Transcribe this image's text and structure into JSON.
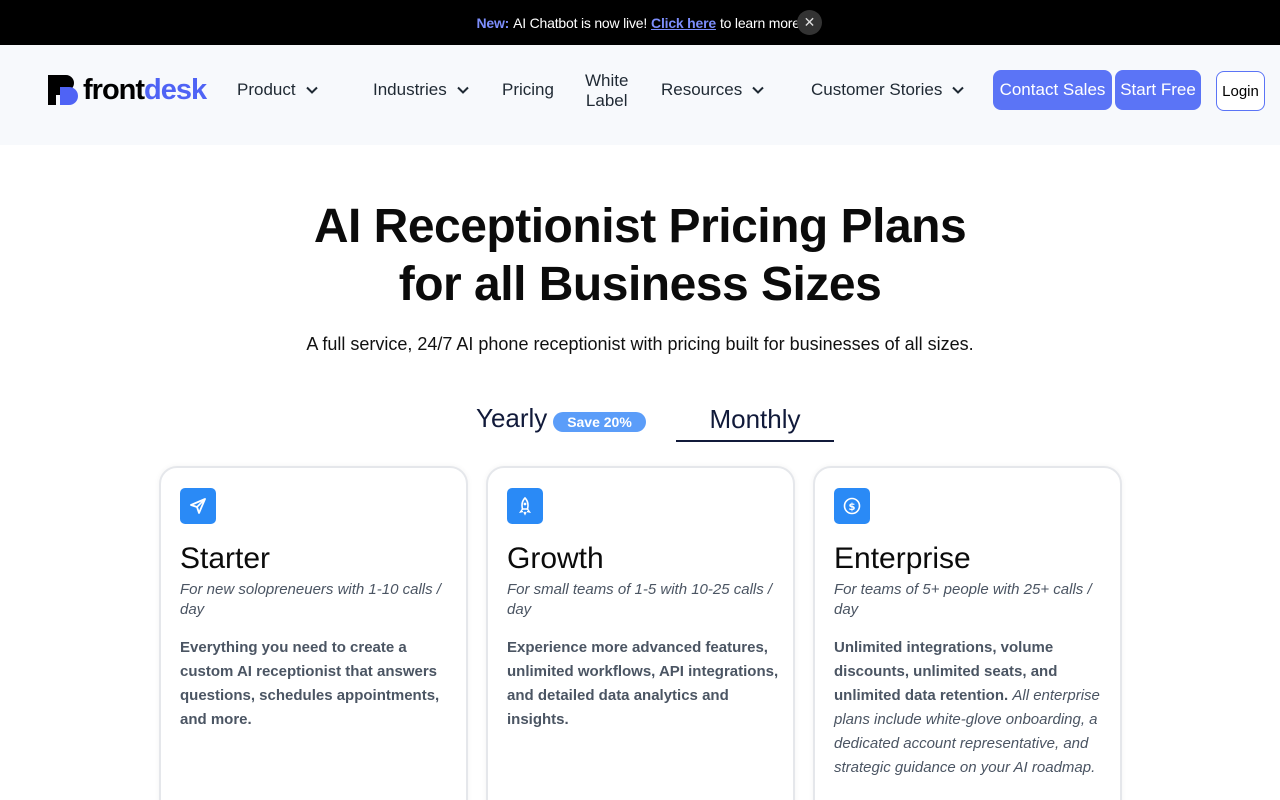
{
  "announcement": {
    "new_label": "New:",
    "text": "AI Chatbot is now live!",
    "link": "Click here",
    "after": "to learn more.",
    "close": "✕"
  },
  "header": {
    "logo_front": "front",
    "logo_desk": "desk",
    "nav": {
      "product": "Product",
      "industries": "Industries",
      "pricing": "Pricing",
      "white_label_1": "White",
      "white_label_2": "Label",
      "resources": "Resources",
      "customer_stories": "Customer Stories"
    },
    "contact_sales": "Contact Sales",
    "start_free": "Start Free",
    "login": "Login"
  },
  "hero": {
    "title_line1": "AI Receptionist Pricing Plans",
    "title_line2": "for all Business Sizes",
    "subtitle": "A full service, 24/7 AI phone receptionist with pricing built for businesses of all sizes."
  },
  "billing": {
    "yearly": "Yearly",
    "save_badge": "Save 20%",
    "monthly": "Monthly",
    "selected": "Monthly"
  },
  "plans": [
    {
      "icon": "paper-plane-icon",
      "icon_color": "#2a8af6",
      "name": "Starter",
      "for": "For new solopreneuers with 1-10 calls / day",
      "description": "Everything you need to create a custom AI receptionist that answers questions, schedules appointments, and more.",
      "description_italic": ""
    },
    {
      "icon": "rocket-icon",
      "icon_color": "#2a8af6",
      "name": "Growth",
      "for": "For small teams of 1-5 with 10-25 calls / day",
      "description": "Experience more advanced features, unlimited workflows, API integrations, and detailed data analytics and insights.",
      "description_italic": ""
    },
    {
      "icon": "dollar-coin-icon",
      "icon_color": "#2a8af6",
      "name": "Enterprise",
      "for": "For teams of 5+ people with 25+ calls / day",
      "description": "Unlimited integrations, volume discounts, unlimited seats, and unlimited data retention.",
      "description_italic": "All enterprise plans include white-glove onboarding, a dedicated account representative, and strategic guidance on your AI roadmap."
    }
  ],
  "colors": {
    "accent": "#5b74f6",
    "badge": "#5b9df9",
    "icon_bg": "#2a8af6",
    "navy": "#111a3a"
  }
}
